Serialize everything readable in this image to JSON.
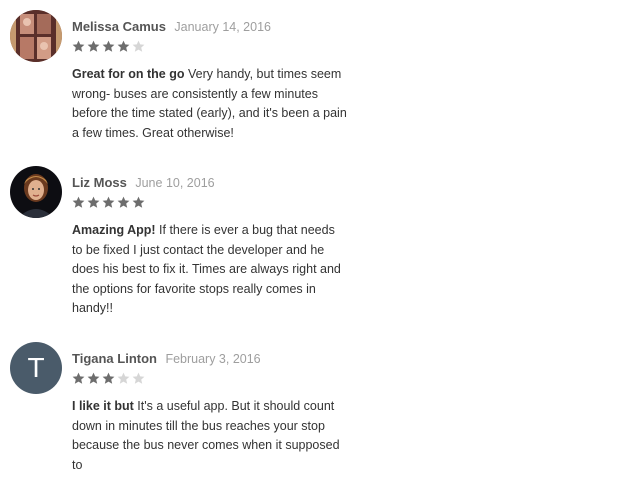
{
  "colors": {
    "star_filled": "#6d6d6d",
    "star_empty": "#d6d6d6",
    "author": "#555555",
    "date": "#9e9e9e",
    "letter_avatar_bg": "#4a5b6a"
  },
  "reviews": [
    {
      "author": "Melissa Camus",
      "date": "January 14, 2016",
      "rating": 4,
      "max_rating": 5,
      "title": "Great for on the go",
      "text": " Very handy, but times seem wrong- buses are consistently a few minutes before the time stated (early), and it's been a pain a few times. Great otherwise!",
      "avatar": "photo"
    },
    {
      "author": "Liz Moss",
      "date": "June 10, 2016",
      "rating": 5,
      "max_rating": 5,
      "title": "Amazing App!",
      "text": " If there is ever a bug that needs to be fixed I just contact the developer and he does his best to fix it. Times are always right and the options for favorite stops really comes in handy!!",
      "avatar": "photo"
    },
    {
      "author": "Tigana Linton",
      "date": "February 3, 2016",
      "rating": 3,
      "max_rating": 5,
      "title": "I like it but",
      "text": " It's a useful app. But it should count down in minutes till the bus reaches your stop because the bus never comes when it supposed to",
      "avatar": "letter",
      "avatar_letter": "T"
    }
  ]
}
